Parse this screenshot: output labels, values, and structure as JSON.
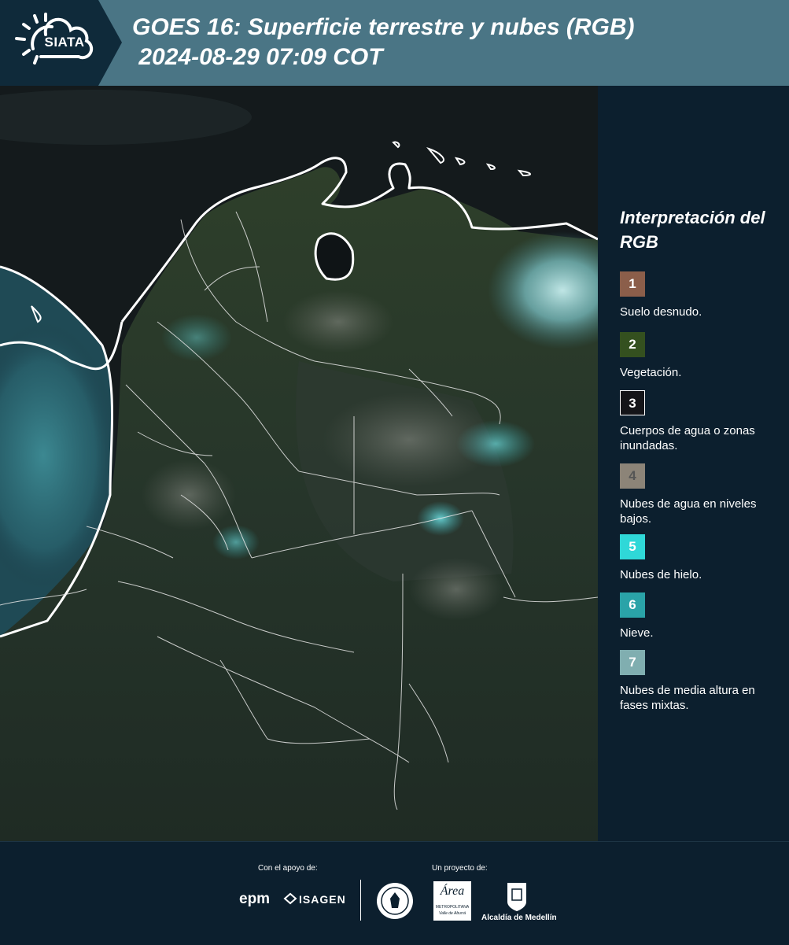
{
  "header": {
    "logo_text": "SIATA",
    "title_line1": "GOES 16: Superficie terrestre y nubes (RGB)",
    "title_line2": " 2024-08-29 07:09 COT"
  },
  "legend": {
    "title": "Interpretación del RGB",
    "items": [
      {
        "num": "1",
        "label": "Suelo desnudo.",
        "color": "#8b5e4a"
      },
      {
        "num": "2",
        "label": "Vegetación.",
        "color": "#34501f"
      },
      {
        "num": "3",
        "label": "Cuerpos de agua o zonas inundadas.",
        "color": "#141418"
      },
      {
        "num": "4",
        "label": "Nubes de agua en niveles bajos.",
        "color": "#8c8478"
      },
      {
        "num": "5",
        "label": "Nubes de hielo.",
        "color": "#2fd8d8"
      },
      {
        "num": "6",
        "label": "Nieve.",
        "color": "#2aa3a8"
      },
      {
        "num": "7",
        "label": "Nubes de media altura en fases mixtas.",
        "color": "#80aeb0"
      }
    ]
  },
  "footer": {
    "support_caption": "Con el apoyo de:",
    "project_caption": "Un proyecto de:",
    "epm": "epm",
    "isagen": "ISAGEN",
    "area_name": "Área",
    "area_sub1": "METROPOLITANA",
    "area_sub2": "Valle de Aburrá",
    "alcaldia": "Alcaldía de Medellín"
  },
  "colors": {
    "header_bg": "#4a7585",
    "logo_bg": "#0f2a3a",
    "panel_bg": "#0c1f2e"
  }
}
